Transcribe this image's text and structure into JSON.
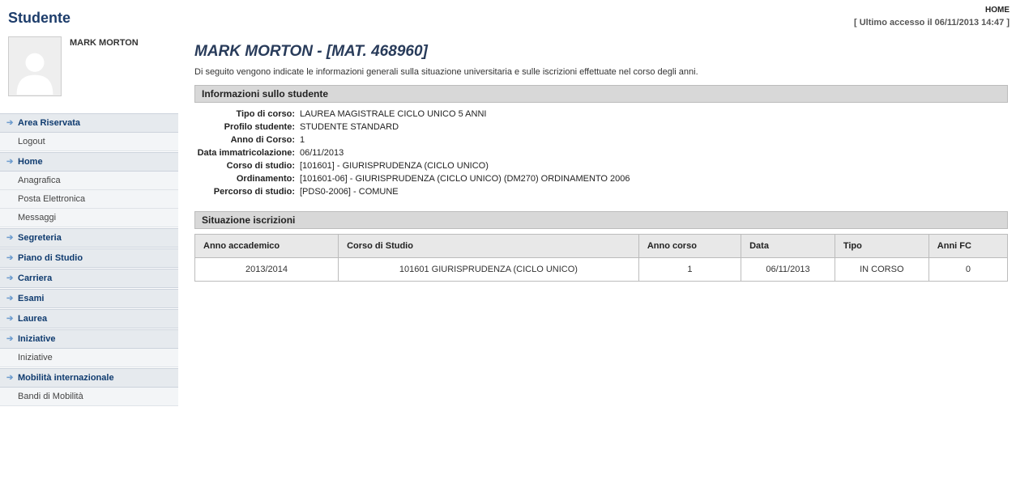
{
  "top": {
    "home_label": "HOME",
    "last_access": "[ Ultimo accesso il 06/11/2013 14:47 ]"
  },
  "sidebar": {
    "title": "Studente",
    "student_name": "MARK MORTON",
    "groups": [
      {
        "heading": "Area Riservata",
        "items": [
          "Logout"
        ]
      },
      {
        "heading": "Home",
        "items": [
          "Anagrafica",
          "Posta Elettronica",
          "Messaggi"
        ]
      },
      {
        "heading": "Segreteria",
        "items": []
      },
      {
        "heading": "Piano di Studio",
        "items": []
      },
      {
        "heading": "Carriera",
        "items": []
      },
      {
        "heading": "Esami",
        "items": []
      },
      {
        "heading": "Laurea",
        "items": []
      },
      {
        "heading": "Iniziative",
        "items": [
          "Iniziative"
        ]
      },
      {
        "heading": "Mobilità internazionale",
        "items": [
          "Bandi di Mobilità"
        ]
      }
    ]
  },
  "main": {
    "title": "MARK MORTON - [MAT. 468960]",
    "intro": "Di seguito vengono indicate le informazioni generali sulla situazione universitaria e sulle iscrizioni effettuate nel corso degli anni.",
    "section_info_title": "Informazioni sullo studente",
    "info": [
      {
        "label": "Tipo di corso:",
        "value": "LAUREA MAGISTRALE CICLO UNICO 5 ANNI"
      },
      {
        "label": "Profilo studente:",
        "value": "STUDENTE STANDARD"
      },
      {
        "label": "Anno di Corso:",
        "value": "1"
      },
      {
        "label": "Data immatricolazione:",
        "value": "06/11/2013"
      },
      {
        "label": "Corso di studio:",
        "value": "[101601] - GIURISPRUDENZA (CICLO UNICO)"
      },
      {
        "label": "Ordinamento:",
        "value": "[101601-06] - GIURISPRUDENZA (CICLO UNICO) (DM270) ORDINAMENTO 2006"
      },
      {
        "label": "Percorso di studio:",
        "value": "[PDS0-2006] - COMUNE"
      }
    ],
    "section_enroll_title": "Situazione iscrizioni",
    "enroll_headers": [
      "Anno accademico",
      "Corso di Studio",
      "Anno corso",
      "Data",
      "Tipo",
      "Anni FC"
    ],
    "enroll_rows": [
      {
        "anno_acc": "2013/2014",
        "corso": "101601 GIURISPRUDENZA (CICLO UNICO)",
        "anno_corso": "1",
        "data": "06/11/2013",
        "tipo": "IN CORSO",
        "anni_fc": "0"
      }
    ]
  }
}
